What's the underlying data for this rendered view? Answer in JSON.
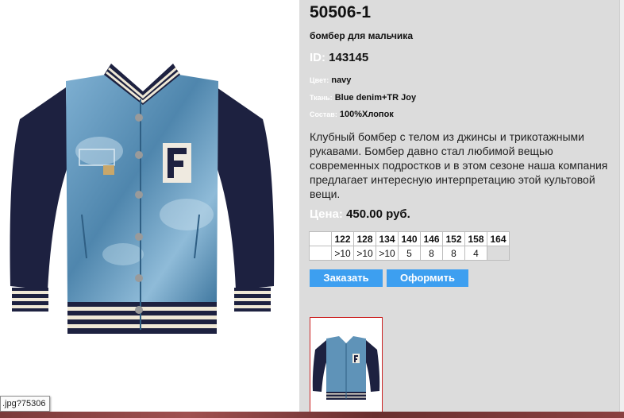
{
  "product": {
    "sku": "50506-1",
    "subtitle": "бомбер для мальчика",
    "id_label": "ID:",
    "id_value": "143145",
    "color_label": "Цвет:",
    "color_value": "navy",
    "fabric_label": "Ткань:",
    "fabric_value": "Blue denim+TR Joy",
    "composition_label": "Состав:",
    "composition_value": "100%Хлопок",
    "description": "Клубный бомбер с телом из джинсы и трикотажными рукавами. Бомбер давно стал любимой вещью современных подростков и в этом сезоне наша компания предлагает интересную интерпретацию этой культовой вещи.",
    "price_label": "Цена:",
    "price_value": "450.00 руб."
  },
  "sizes": {
    "headers": [
      "122",
      "128",
      "134",
      "140",
      "146",
      "152",
      "158",
      "164"
    ],
    "stock": [
      ">10",
      ">10",
      ">10",
      "5",
      "8",
      "8",
      "4",
      ""
    ]
  },
  "buttons": {
    "order": "Заказать",
    "checkout": "Оформить"
  },
  "tooltip": {
    "text": ".jpg?75306"
  },
  "colors": {
    "panel_bg": "#dcdcdc",
    "button_bg": "#3d9ff0",
    "thumb_border": "#cc2222",
    "denim": "#5f93b8",
    "sleeve_navy": "#1d2140"
  }
}
